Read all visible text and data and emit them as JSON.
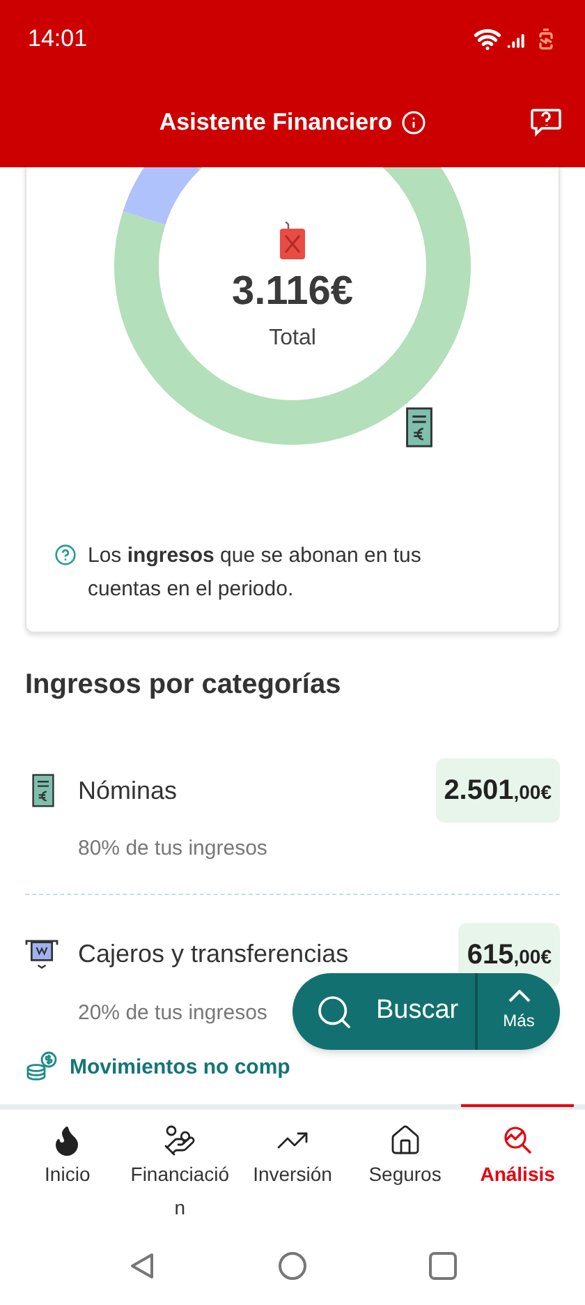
{
  "status_bar": {
    "time": "14:01"
  },
  "header": {
    "title": "Asistente Financiero"
  },
  "chart": {
    "total": "3.116€",
    "label": "Total"
  },
  "info": {
    "text": "Los **ingresos** que se abonan en tus cuentas en el periodo."
  },
  "section_title": "Ingresos por categorías",
  "categories": [
    {
      "kind": "payslip",
      "name": "Nóminas",
      "amount": "2.501",
      "decimals": ",00€",
      "share": "80% de tus ingresos"
    },
    {
      "kind": "atm",
      "name": "Cajeros y transferencias",
      "amount": "615",
      "decimals": ",00€",
      "share": "20% de tus ingresos"
    }
  ],
  "link": {
    "label": "Movimientos no comp"
  },
  "fab": {
    "label": "Buscar",
    "more": "Más"
  },
  "nav": [
    {
      "kind": "home",
      "label": "Inicio",
      "selected": false
    },
    {
      "kind": "finance",
      "label": "Financiación",
      "selected": false
    },
    {
      "kind": "invest",
      "label": "Inversión",
      "selected": false
    },
    {
      "kind": "insurance",
      "label": "Seguros",
      "selected": false
    },
    {
      "kind": "analysis",
      "label": "Análisis",
      "selected": true
    }
  ]
}
